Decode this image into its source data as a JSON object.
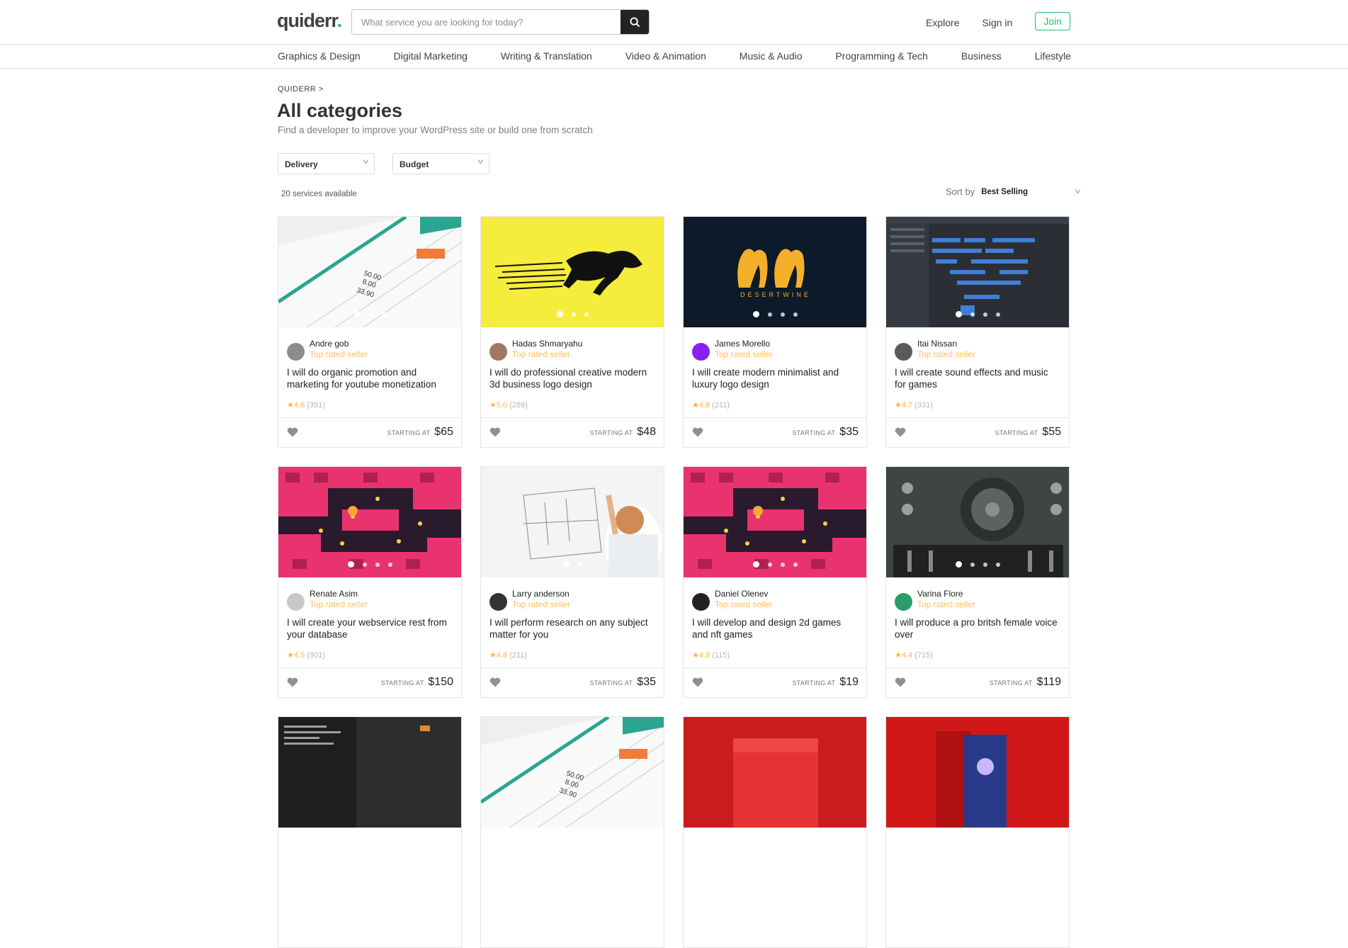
{
  "brand": {
    "name": "quiderr",
    "dot": "."
  },
  "search": {
    "placeholder": "What service you are looking for today?"
  },
  "header_nav": {
    "explore": "Explore",
    "signin": "Sign in",
    "join": "Join"
  },
  "categories": [
    "Graphics & Design",
    "Digital Marketing",
    "Writing & Translation",
    "Video & Animation",
    "Music & Audio",
    "Programming & Tech",
    "Business",
    "Lifestyle"
  ],
  "breadcrumb": "QUIDERR >",
  "page_title": "All categories",
  "page_subtitle": "Find a developer to improve your WordPress site or build one from scratch",
  "filters": {
    "delivery": "Delivery",
    "budget": "Budget"
  },
  "services_count": "20 services available",
  "sort": {
    "label": "Sort by",
    "value": "Best Selling"
  },
  "colors": {
    "accent": "#1dbf73",
    "star": "#ffb33e",
    "badge": "#ffbe5b"
  },
  "gigs": [
    {
      "seller": "Andre gob",
      "badge": "Top rated seller",
      "title": "I will do organic promotion and marketing for youtube monetization",
      "rating": "4.6",
      "reviews": "(391)",
      "starting": "STARTING AT",
      "price": "$65",
      "thumb": "spreadsheet",
      "dots": 3,
      "active_dot": 1
    },
    {
      "seller": "Hadas Shmaryahu",
      "badge": "Top rated seller",
      "title": "I will do professional creative modern 3d business logo design",
      "rating": "5.0",
      "reviews": "(289)",
      "starting": "STARTING AT",
      "price": "$48",
      "thumb": "cheetah",
      "dots": 3,
      "active_dot": 1
    },
    {
      "seller": "James Morello",
      "badge": "Top rated seller",
      "title": "I will create modern minimalist and luxury logo design",
      "rating": "4.8",
      "reviews": "(211)",
      "starting": "STARTING AT",
      "price": "$35",
      "thumb": "desertwine",
      "dots": 4,
      "active_dot": 1,
      "thumb_text": "DESERTWINE"
    },
    {
      "seller": "Itai Nissan",
      "badge": "Top rated seller",
      "title": "I will create sound effects and music for games",
      "rating": "4.7",
      "reviews": "(331)",
      "starting": "STARTING AT",
      "price": "$55",
      "thumb": "daw",
      "dots": 4,
      "active_dot": 1
    },
    {
      "seller": "Renate Asim",
      "badge": "Top rated seller",
      "title": "I will create your webservice rest from your database",
      "rating": "4.5",
      "reviews": "(901)",
      "starting": "STARTING AT",
      "price": "$150",
      "thumb": "game",
      "dots": 4,
      "active_dot": 1
    },
    {
      "seller": "Larry anderson",
      "badge": "Top rated seller",
      "title": "I will perform research on any subject matter for you",
      "rating": "4.8",
      "reviews": "(211)",
      "starting": "STARTING AT",
      "price": "$35",
      "thumb": "whiteboard",
      "dots": 2,
      "active_dot": 1
    },
    {
      "seller": "Daniel Olenev",
      "badge": "Top rated seller",
      "title": "I will develop and design 2d games and nft games",
      "rating": "4.9",
      "reviews": "(115)",
      "starting": "STARTING AT",
      "price": "$19",
      "thumb": "game",
      "dots": 4,
      "active_dot": 1
    },
    {
      "seller": "Varina Flore",
      "badge": "Top rated seller",
      "title": "I will produce a pro britsh female voice over",
      "rating": "4.4",
      "reviews": "(715)",
      "starting": "STARTING AT",
      "price": "$119",
      "thumb": "mixer",
      "dots": 4,
      "active_dot": 1
    },
    {
      "thumb": "code"
    },
    {
      "thumb": "spreadsheet"
    },
    {
      "thumb": "redbox"
    },
    {
      "thumb": "redbooks"
    }
  ]
}
